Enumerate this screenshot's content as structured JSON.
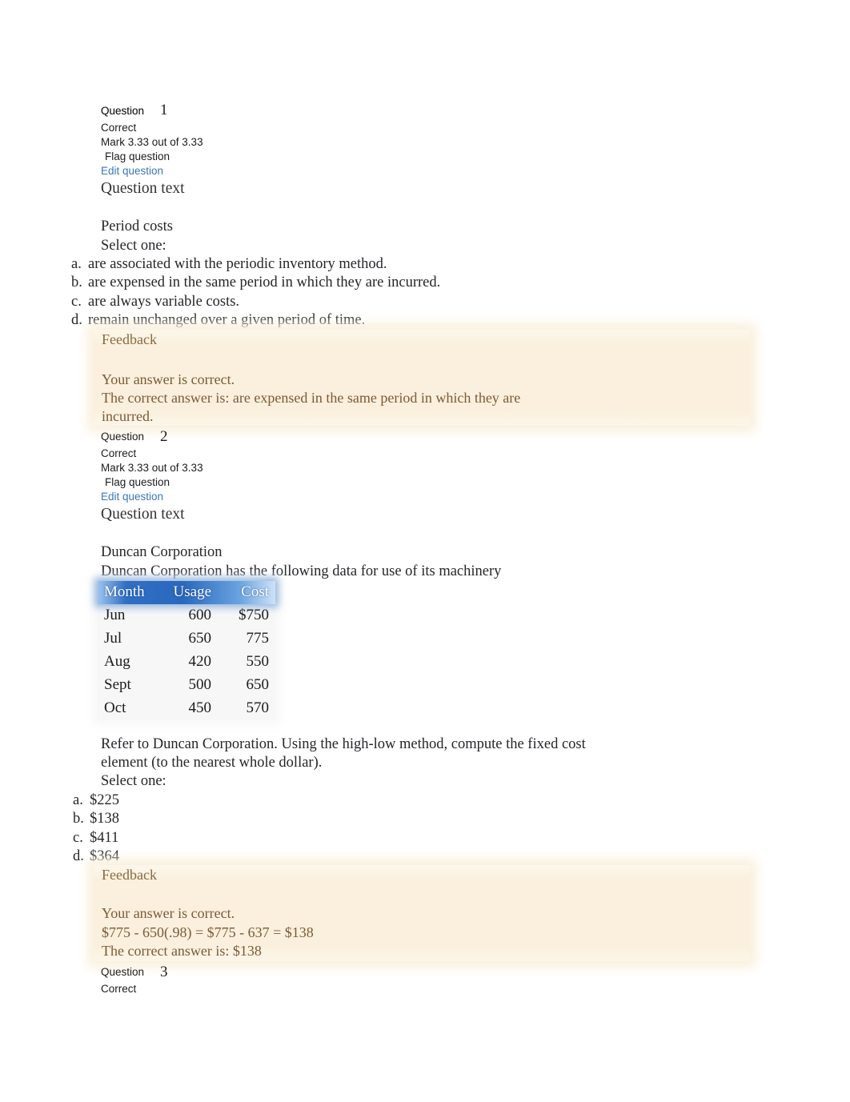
{
  "document": {
    "type": "quiz-review",
    "labels": {
      "question_word": "Question",
      "status": "Correct",
      "flag_question": "Flag question",
      "edit_question": "Edit question",
      "question_text_heading": "Question text",
      "select_one": "Select one:",
      "feedback_heading": "Feedback"
    },
    "colors": {
      "link": "#3a76b8",
      "feedback_bg": "#faf0dd",
      "feedback_text": "#7c5a37",
      "table_header_bg": "#2a68bd",
      "body_text": "#26262b"
    }
  },
  "questions": [
    {
      "number": "1",
      "status": "Correct",
      "mark": "Mark 3.33 out of 3.33",
      "flag": "Flag question",
      "edit": "Edit question",
      "heading": "Question text",
      "stem": "Period costs",
      "select_one": "Select one:",
      "options": [
        {
          "letter": "a.",
          "text": "are associated with the periodic inventory method."
        },
        {
          "letter": "b.",
          "text": "are expensed in the same period in which they are incurred."
        },
        {
          "letter": "c.",
          "text": "are always variable costs."
        },
        {
          "letter": "d.",
          "text": "remain unchanged over a given period of time."
        }
      ],
      "feedback": {
        "title": "Feedback",
        "lines": [
          "Your answer is correct.",
          "The correct answer is: are expensed in the same period in which they are",
          "incurred."
        ]
      }
    },
    {
      "number": "2",
      "status": "Correct",
      "mark": "Mark 3.33 out of 3.33",
      "flag": "Flag question",
      "edit": "Edit question",
      "heading": "Question text",
      "stem_title": "Duncan Corporation",
      "stem_intro": "Duncan Corporation has the following data for use of its machinery",
      "table": {
        "headers": [
          "Month",
          "Usage",
          "Cost"
        ],
        "rows": [
          [
            "Jun",
            "600",
            "$750"
          ],
          [
            "Jul",
            "650",
            "775"
          ],
          [
            "Aug",
            "420",
            "550"
          ],
          [
            "Sept",
            "500",
            "650"
          ],
          [
            "Oct",
            "450",
            "570"
          ]
        ]
      },
      "prompt_line1": "Refer to Duncan Corporation. Using the high-low method, compute the fixed cost",
      "prompt_line2": "element (to the nearest whole dollar).",
      "select_one": "Select one:",
      "options": [
        {
          "letter": "a.",
          "text": "$225"
        },
        {
          "letter": "b.",
          "text": "$138"
        },
        {
          "letter": "c.",
          "text": "$411"
        },
        {
          "letter": "d.",
          "text": "$364"
        }
      ],
      "feedback": {
        "title": "Feedback",
        "lines": [
          "Your answer is correct.",
          "$775 - 650(.98) = $775 - 637 = $138",
          "The correct answer is: $138"
        ]
      }
    },
    {
      "number": "3",
      "status": "Correct"
    }
  ]
}
